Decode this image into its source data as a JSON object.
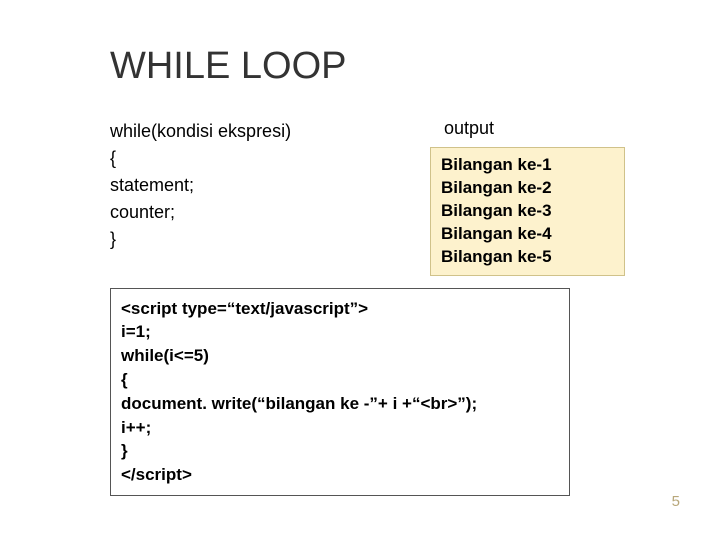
{
  "title": "WHILE LOOP",
  "syntax": {
    "line1": "while(kondisi ekspresi)",
    "line2": "{",
    "line3": "statement;",
    "line4": "counter;",
    "line5": "}"
  },
  "output": {
    "label": "output",
    "lines": [
      "Bilangan ke-1",
      "Bilangan ke-2",
      "Bilangan ke-3",
      "Bilangan ke-4",
      "Bilangan ke-5"
    ]
  },
  "code": {
    "line1": "<script type=“text/javascript”>",
    "line2": "i=1;",
    "line3": "while(i<=5)",
    "line4": "{",
    "line5": "document. write(“bilangan ke -”+ i +“<br>”);",
    "line6": "i++;",
    "line7": "}",
    "line8": "</script>"
  },
  "page_number": "5"
}
